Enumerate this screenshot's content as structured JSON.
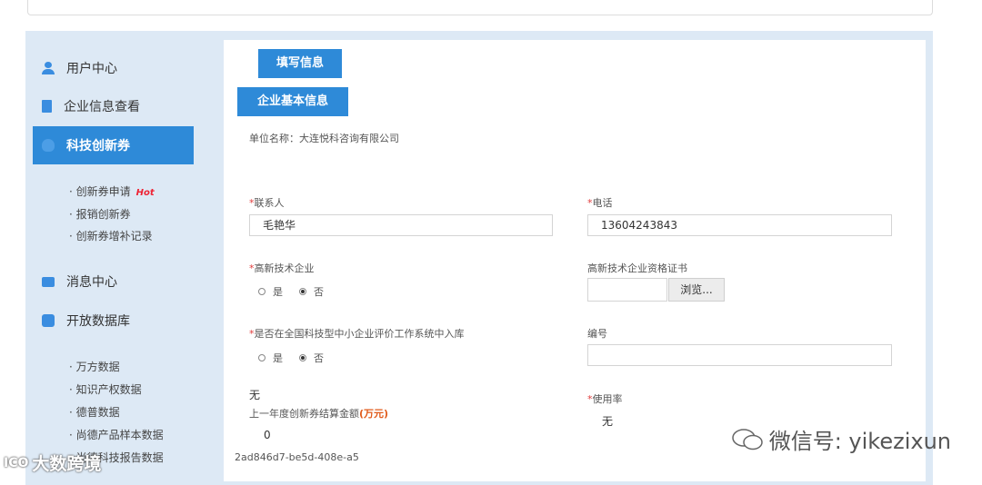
{
  "sidebar": {
    "items": [
      {
        "label": "用户中心",
        "icon": "user-icon"
      },
      {
        "label": "企业信息查看",
        "icon": "document-icon"
      },
      {
        "label": "科技创新券",
        "icon": "shield-icon"
      },
      {
        "label": "消息中心",
        "icon": "message-icon"
      },
      {
        "label": "开放数据库",
        "icon": "database-icon"
      }
    ],
    "voucher_sub": [
      "· 创新券申请",
      "· 报销创新券",
      "· 创新券增补记录"
    ],
    "hot_badge": "Hot",
    "db_sub": [
      "· 万方数据",
      "· 知识产权数据",
      "· 德普数据",
      "· 尚德产品样本数据",
      "· 尚德科技报告数据"
    ]
  },
  "form": {
    "fill_button": "填写信息",
    "section_button": "企业基本信息",
    "company_line": "单位名称：大连悦科咨询有限公司",
    "contact_label": "联系人",
    "contact_value": "毛艳华",
    "phone_label": "电话",
    "phone_value": "13604243843",
    "hightech_label": "高新技术企业",
    "yes": "是",
    "no": "否",
    "cert_label": "高新技术企业资格证书",
    "browse": "浏览...",
    "evaluation_label": "是否在全国科技型中小企业评价工作系统中入库",
    "number_label": "编号",
    "none_text": "无",
    "last_year_label": "上一年度创新券结算金额",
    "unit": "(万元)",
    "last_year_value": "0",
    "usage_label": "使用率",
    "usage_value": "无",
    "hash": "2ad846d7-be5d-408e-a5",
    "required_mark": "*"
  },
  "watermark": {
    "right": "微信号: yikezixun",
    "left": "大数跨境",
    "left_logo": "ICO"
  },
  "colors": {
    "primary": "#2e8ad8",
    "frame": "#dde9f5",
    "required": "#e03a3a",
    "unit": "#e05a1a"
  }
}
